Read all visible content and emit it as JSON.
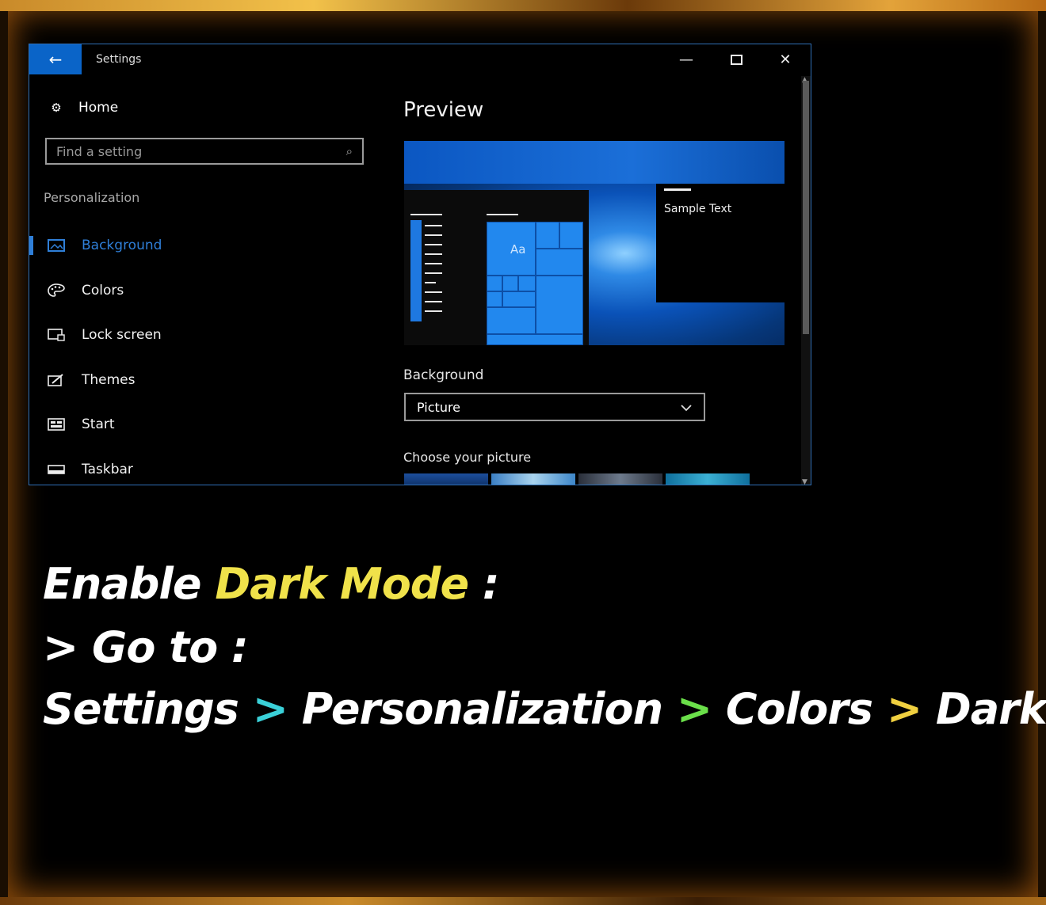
{
  "window": {
    "title": "Settings",
    "back_icon": "back-arrow-icon",
    "controls": {
      "minimize": "—",
      "close": "✕"
    }
  },
  "sidebar": {
    "home": {
      "label": "Home",
      "icon": "gear-icon"
    },
    "search": {
      "placeholder": "Find a setting",
      "icon": "search-icon"
    },
    "section": "Personalization",
    "items": [
      {
        "label": "Background",
        "icon": "picture-icon",
        "active": true
      },
      {
        "label": "Colors",
        "icon": "palette-icon",
        "active": false
      },
      {
        "label": "Lock screen",
        "icon": "lock-screen-icon",
        "active": false
      },
      {
        "label": "Themes",
        "icon": "brush-icon",
        "active": false
      },
      {
        "label": "Start",
        "icon": "start-icon",
        "active": false
      },
      {
        "label": "Taskbar",
        "icon": "taskbar-icon",
        "active": false
      }
    ]
  },
  "main": {
    "preview_heading": "Preview",
    "preview": {
      "tile_text": "Aa",
      "sample_text": "Sample Text"
    },
    "background_label": "Background",
    "background_value": "Picture",
    "choose_label": "Choose your picture"
  },
  "caption": {
    "line1_a": "Enable ",
    "line1_b": "Dark Mode",
    "line1_c": " :",
    "line2": "> Go to :",
    "path": [
      "Settings",
      "Personalization",
      "Colors",
      "Dark"
    ],
    "separator": ">"
  },
  "colors": {
    "accent": "#0a64c8",
    "highlight_yellow": "#f0e24a",
    "sep1": "#3ad0d8",
    "sep2": "#6be04a",
    "sep3": "#f0d040"
  }
}
